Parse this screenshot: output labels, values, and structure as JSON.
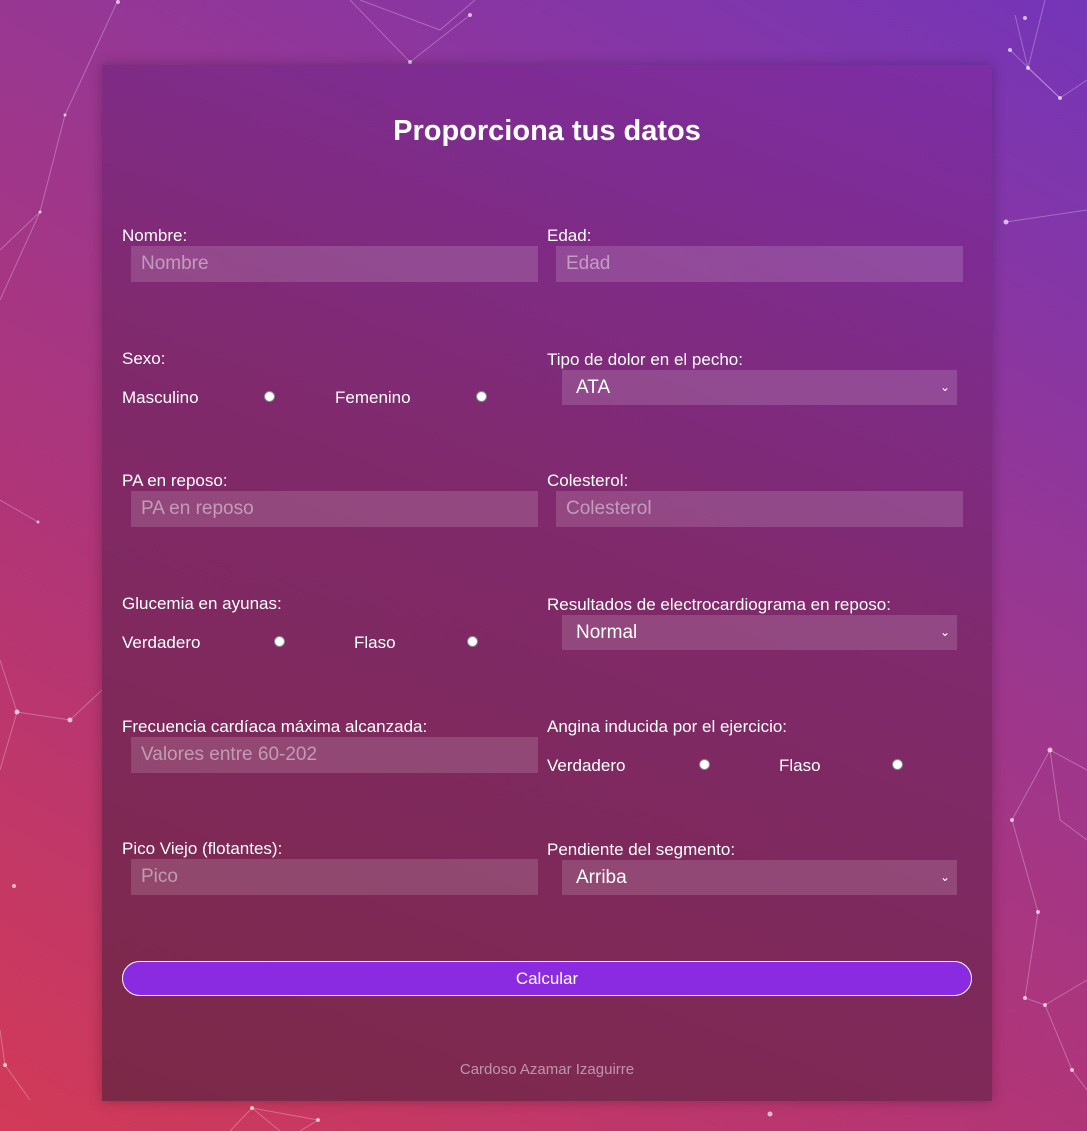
{
  "form": {
    "title": "Proporciona tus datos",
    "nombre": {
      "label": "Nombre:",
      "placeholder": "Nombre"
    },
    "edad": {
      "label": "Edad:",
      "placeholder": "Edad"
    },
    "sexo": {
      "label": "Sexo:",
      "options": [
        "Masculino",
        "Femenino"
      ]
    },
    "tipo_dolor": {
      "label": "Tipo de dolor en el pecho:",
      "selected": "ATA"
    },
    "pa_reposo": {
      "label": "PA en reposo:",
      "placeholder": "PA en reposo"
    },
    "colesterol": {
      "label": "Colesterol:",
      "placeholder": "Colesterol"
    },
    "glucemia": {
      "label": "Glucemia en ayunas:",
      "options": [
        "Verdadero",
        "Flaso"
      ]
    },
    "ecg": {
      "label": "Resultados de electrocardiograma en reposo:",
      "selected": "Normal"
    },
    "frecuencia": {
      "label": "Frecuencia cardíaca máxima alcanzada:",
      "placeholder": "Valores entre 60-202"
    },
    "angina": {
      "label": "Angina inducida por el ejercicio:",
      "options": [
        "Verdadero",
        "Flaso"
      ]
    },
    "pico": {
      "label": "Pico Viejo (flotantes):",
      "placeholder": "Pico"
    },
    "pendiente": {
      "label": "Pendiente del segmento:",
      "selected": "Arriba"
    },
    "submit_label": "Calcular",
    "footer": "Cardoso Azamar Izaguirre"
  },
  "colors": {
    "button": "#8a2be2",
    "background_start": "#d23a57",
    "background_end": "#7435b8"
  }
}
